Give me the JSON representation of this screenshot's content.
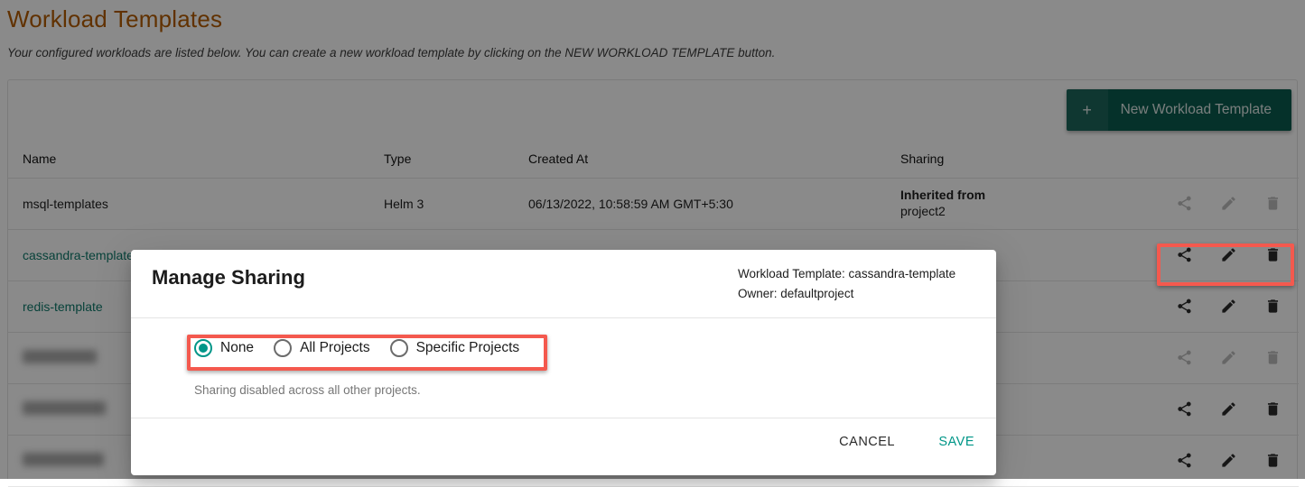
{
  "page": {
    "title": "Workload Templates",
    "subtitle": "Your configured workloads are listed below. You can create a new workload template by clicking on the NEW WORKLOAD TEMPLATE button.",
    "title_color": "#b35c00"
  },
  "toolbar": {
    "new_template_label": "New Workload Template",
    "new_template_plus": "+",
    "button_color": "#0b5c4f"
  },
  "table": {
    "columns": [
      "Name",
      "Type",
      "Created At",
      "Sharing",
      ""
    ],
    "rows": [
      {
        "name": "msql-templates",
        "name_is_link": false,
        "type": "Helm 3",
        "created_at": "06/13/2022, 10:58:59 AM GMT+5:30",
        "sharing_primary": "Inherited from",
        "sharing_secondary": "project2",
        "actions_enabled": false,
        "redacted": false
      },
      {
        "name": "cassandra-template",
        "name_is_link": true,
        "type": "",
        "created_at": "",
        "sharing_primary": "",
        "sharing_secondary": "",
        "actions_enabled": true,
        "redacted": false
      },
      {
        "name": "redis-template",
        "name_is_link": true,
        "type": "",
        "created_at": "",
        "sharing_primary": "",
        "sharing_secondary": "",
        "actions_enabled": true,
        "redacted": false
      },
      {
        "name": "",
        "name_is_link": false,
        "type": "",
        "created_at": "",
        "sharing_primary": "",
        "sharing_secondary": "",
        "actions_enabled": false,
        "redacted": true
      },
      {
        "name": "",
        "name_is_link": false,
        "type": "",
        "created_at": "",
        "sharing_primary": "",
        "sharing_secondary": "",
        "actions_enabled": true,
        "redacted": true
      },
      {
        "name": "",
        "name_is_link": false,
        "type": "",
        "created_at": "",
        "sharing_primary": "",
        "sharing_secondary": "",
        "actions_enabled": true,
        "redacted": true
      }
    ],
    "row_action_icons": [
      "share-icon",
      "edit-pencil-icon",
      "delete-trash-icon"
    ]
  },
  "dialog": {
    "title": "Manage Sharing",
    "meta_template": "Workload Template: cassandra-template",
    "meta_owner": "Owner: defaultproject",
    "radio_options": [
      {
        "label": "None",
        "selected": true
      },
      {
        "label": "All Projects",
        "selected": false
      },
      {
        "label": "Specific Projects",
        "selected": false
      }
    ],
    "helper_text": "Sharing disabled across all other projects.",
    "cancel_label": "CANCEL",
    "save_label": "SAVE",
    "accent_color": "#009688"
  },
  "annotations": {
    "highlight_color": "#f4594e",
    "boxes": [
      "row-actions-highlight",
      "sharing-radio-group-highlight"
    ]
  }
}
